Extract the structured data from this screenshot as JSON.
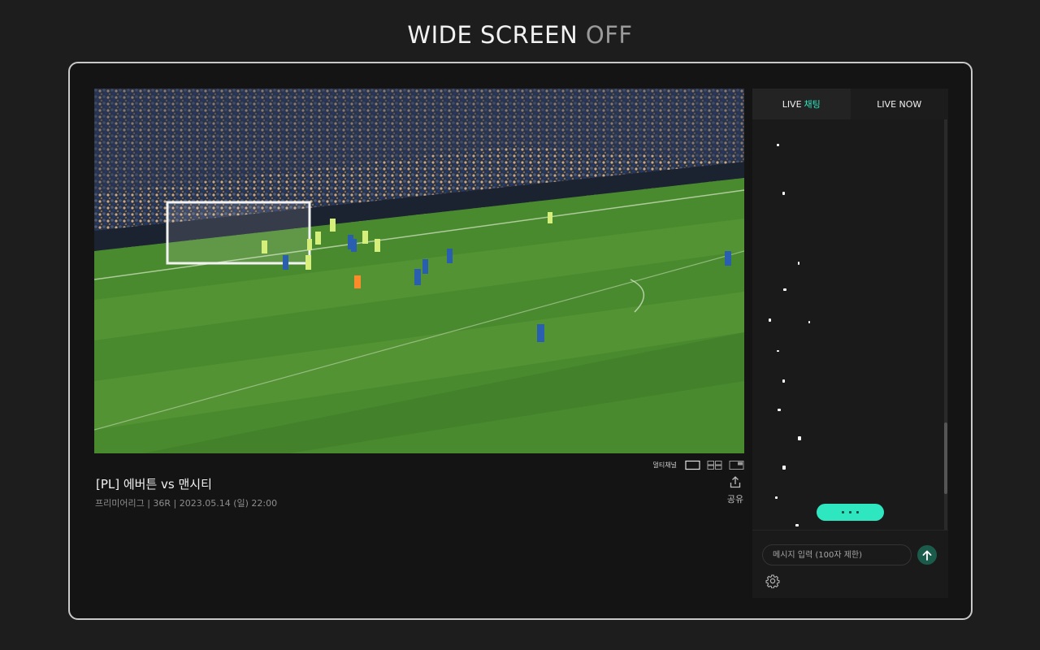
{
  "header": {
    "word": "WIDE SCREEN",
    "state": "OFF"
  },
  "player": {
    "view_controls": {
      "label": "멀티채널",
      "layouts": [
        "single-layout-icon",
        "quad-layout-icon",
        "pip-layout-icon"
      ]
    },
    "match_title": "[PL] 에버튼 vs 맨시티",
    "match_meta": "프리미어리그 | 36R | 2023.05.14 (일) 22:00",
    "share_label": "공유"
  },
  "chat": {
    "tabs": [
      {
        "prefix": "LIVE",
        "accent": "채팅",
        "active": true
      },
      {
        "prefix": "LIVE NOW",
        "accent": "",
        "active": false
      }
    ],
    "input_placeholder": "메시지 입력 (100자 제한)"
  },
  "colors": {
    "accent": "#2ee6c0",
    "send_button": "#1b5b4c",
    "background": "#1d1d1d"
  }
}
